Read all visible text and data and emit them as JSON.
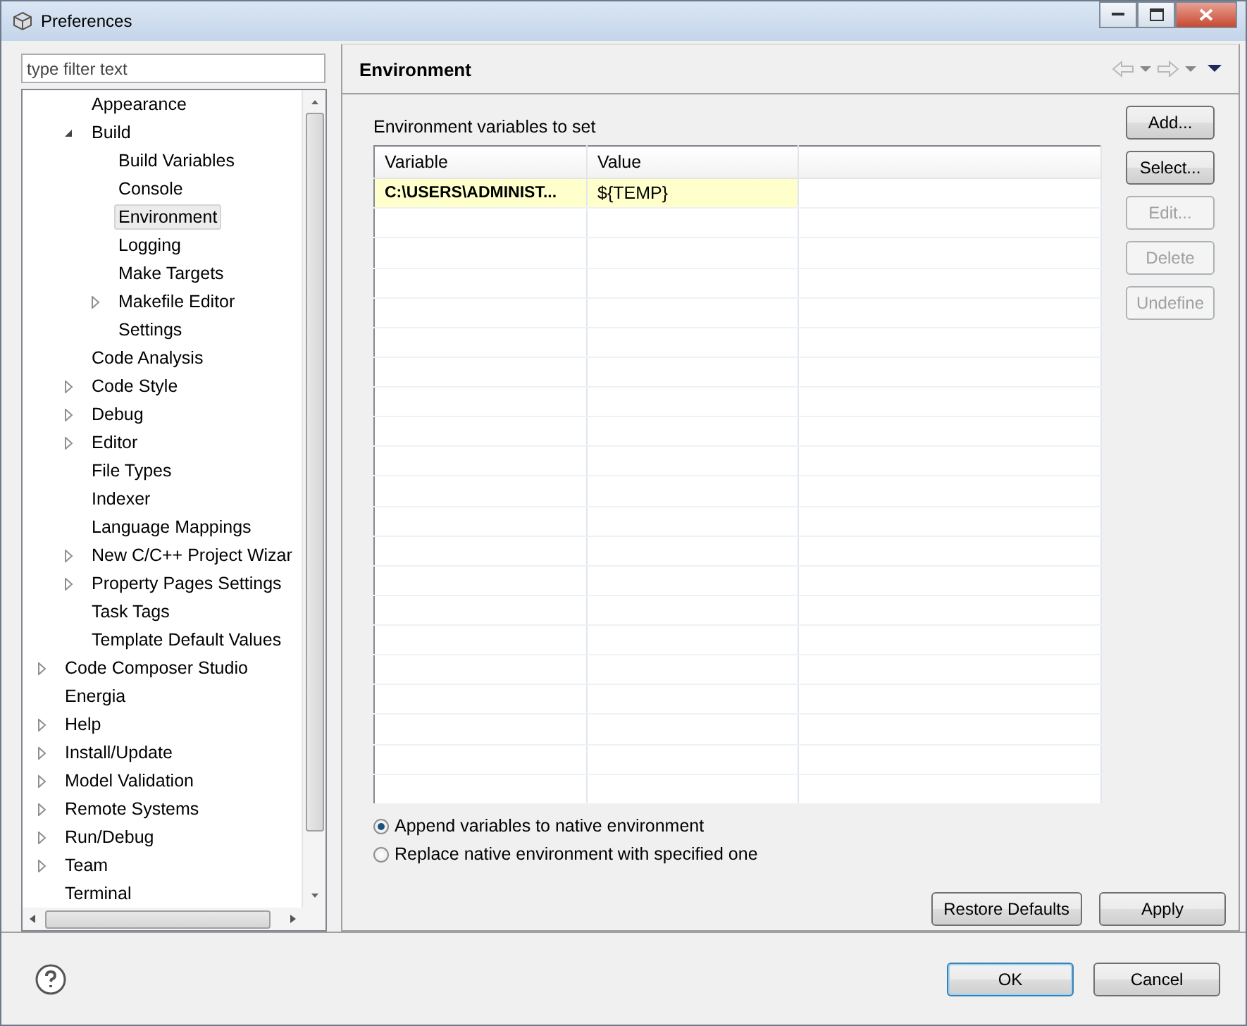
{
  "window": {
    "title": "Preferences"
  },
  "filter": {
    "placeholder": "type filter text"
  },
  "tree": {
    "scrolled_branch": [
      {
        "label": "Appearance",
        "selected": false
      },
      {
        "label": "Build",
        "selected": false,
        "expanded": true,
        "children": [
          {
            "label": "Build Variables",
            "selected": false
          },
          {
            "label": "Console",
            "selected": false
          },
          {
            "label": "Environment",
            "selected": true
          },
          {
            "label": "Logging",
            "selected": false
          },
          {
            "label": "Make Targets",
            "selected": false
          },
          {
            "label": "Makefile Editor",
            "selected": false,
            "expanded": false
          },
          {
            "label": "Settings",
            "selected": false
          }
        ]
      },
      {
        "label": "Code Analysis",
        "selected": false
      },
      {
        "label": "Code Style",
        "selected": false,
        "expanded": false
      },
      {
        "label": "Debug",
        "selected": false,
        "expanded": false
      },
      {
        "label": "Editor",
        "selected": false,
        "expanded": false
      },
      {
        "label": "File Types",
        "selected": false
      },
      {
        "label": "Indexer",
        "selected": false
      },
      {
        "label": "Language Mappings",
        "selected": false
      },
      {
        "label": "New C/C++ Project Wizar",
        "selected": false,
        "expanded": false
      },
      {
        "label": "Property Pages Settings",
        "selected": false,
        "expanded": false
      },
      {
        "label": "Task Tags",
        "selected": false
      },
      {
        "label": "Template Default Values",
        "selected": false
      }
    ],
    "items": [
      {
        "label": "Code Composer Studio",
        "selected": false,
        "expanded": false
      },
      {
        "label": "Energia",
        "selected": false
      },
      {
        "label": "Help",
        "selected": false,
        "expanded": false
      },
      {
        "label": "Install/Update",
        "selected": false,
        "expanded": false
      },
      {
        "label": "Model Validation",
        "selected": false,
        "expanded": false
      },
      {
        "label": "Remote Systems",
        "selected": false,
        "expanded": false
      },
      {
        "label": "Run/Debug",
        "selected": false,
        "expanded": false
      },
      {
        "label": "Team",
        "selected": false,
        "expanded": false
      },
      {
        "label": "Terminal",
        "selected": false
      }
    ]
  },
  "page": {
    "title": "Environment",
    "table_label": "Environment variables to set",
    "table": {
      "columns": [
        "Variable",
        "Value"
      ],
      "rows": [
        {
          "variable": "C:\\USERS\\ADMINIST...",
          "value": "${TEMP}",
          "user_defined": true
        }
      ]
    },
    "side_buttons": [
      {
        "label": "Add...",
        "disabled": false
      },
      {
        "label": "Select...",
        "disabled": false
      },
      {
        "label": "Edit...",
        "disabled": true
      },
      {
        "label": "Delete",
        "disabled": true
      },
      {
        "label": "Undefine",
        "disabled": true
      }
    ],
    "options": [
      {
        "label": "Append variables to native environment",
        "selected": true
      },
      {
        "label": "Replace native environment with specified one",
        "selected": false
      }
    ],
    "buttons": [
      "Restore Defaults",
      "Apply"
    ]
  },
  "footer_buttons": [
    {
      "label": "OK",
      "default": true
    },
    {
      "label": "Cancel",
      "default": false
    }
  ]
}
